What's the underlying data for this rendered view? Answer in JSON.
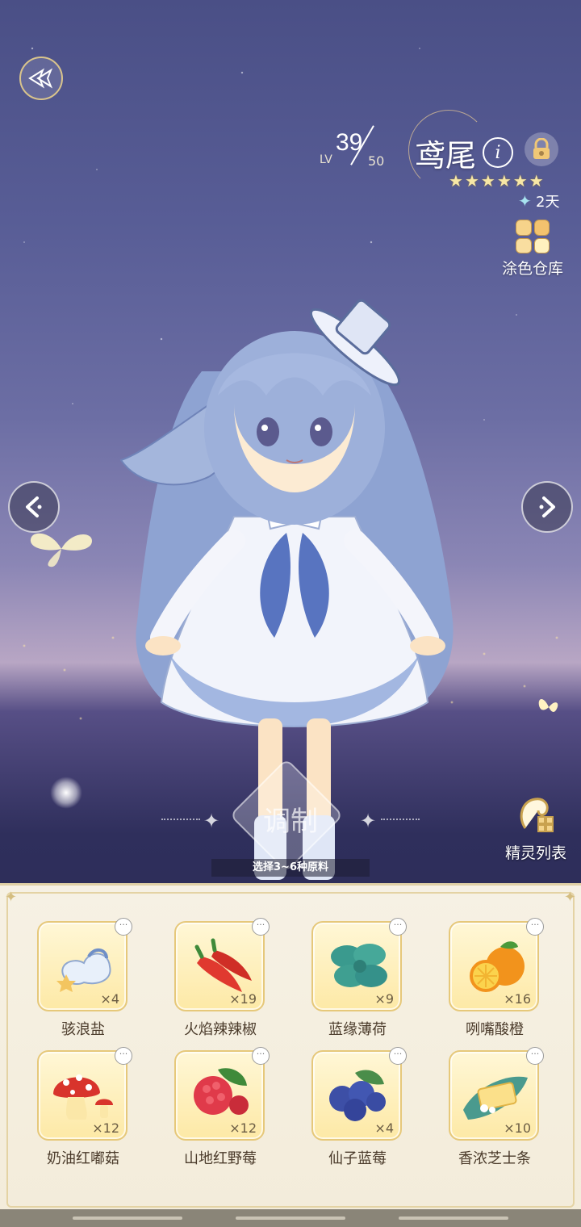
{
  "character": {
    "level_label": "LV",
    "level_current": "39",
    "level_max": "50",
    "name": "鸢尾",
    "info_symbol": "i",
    "stars": 6,
    "star_glyphs": [
      "★",
      "★",
      "★",
      "★",
      "★",
      "★"
    ],
    "days_label": "2天"
  },
  "side": {
    "paint_store_label": "涂色仓库",
    "spirit_list_label": "精灵列表"
  },
  "craft": {
    "button_label": "调制",
    "hint": "选择3~6种原料"
  },
  "ingredients": [
    {
      "name": "骇浪盐",
      "count": "×4",
      "icon": "salt-icon"
    },
    {
      "name": "火焰辣辣椒",
      "count": "×19",
      "icon": "chili-icon"
    },
    {
      "name": "蓝缘薄荷",
      "count": "×9",
      "icon": "mint-icon"
    },
    {
      "name": "咧嘴酸橙",
      "count": "×16",
      "icon": "orange-icon"
    },
    {
      "name": "奶油红嘟菇",
      "count": "×12",
      "icon": "mushroom-icon"
    },
    {
      "name": "山地红野莓",
      "count": "×12",
      "icon": "raspberry-icon"
    },
    {
      "name": "仙子蓝莓",
      "count": "×4",
      "icon": "blueberry-icon"
    },
    {
      "name": "香浓芝士条",
      "count": "×10",
      "icon": "cheese-icon"
    }
  ],
  "more_symbol": "···",
  "colors": {
    "accent_gold": "#e6c87a",
    "panel_bg": "#f6f1e4",
    "card_bg": "#fde9a6"
  }
}
